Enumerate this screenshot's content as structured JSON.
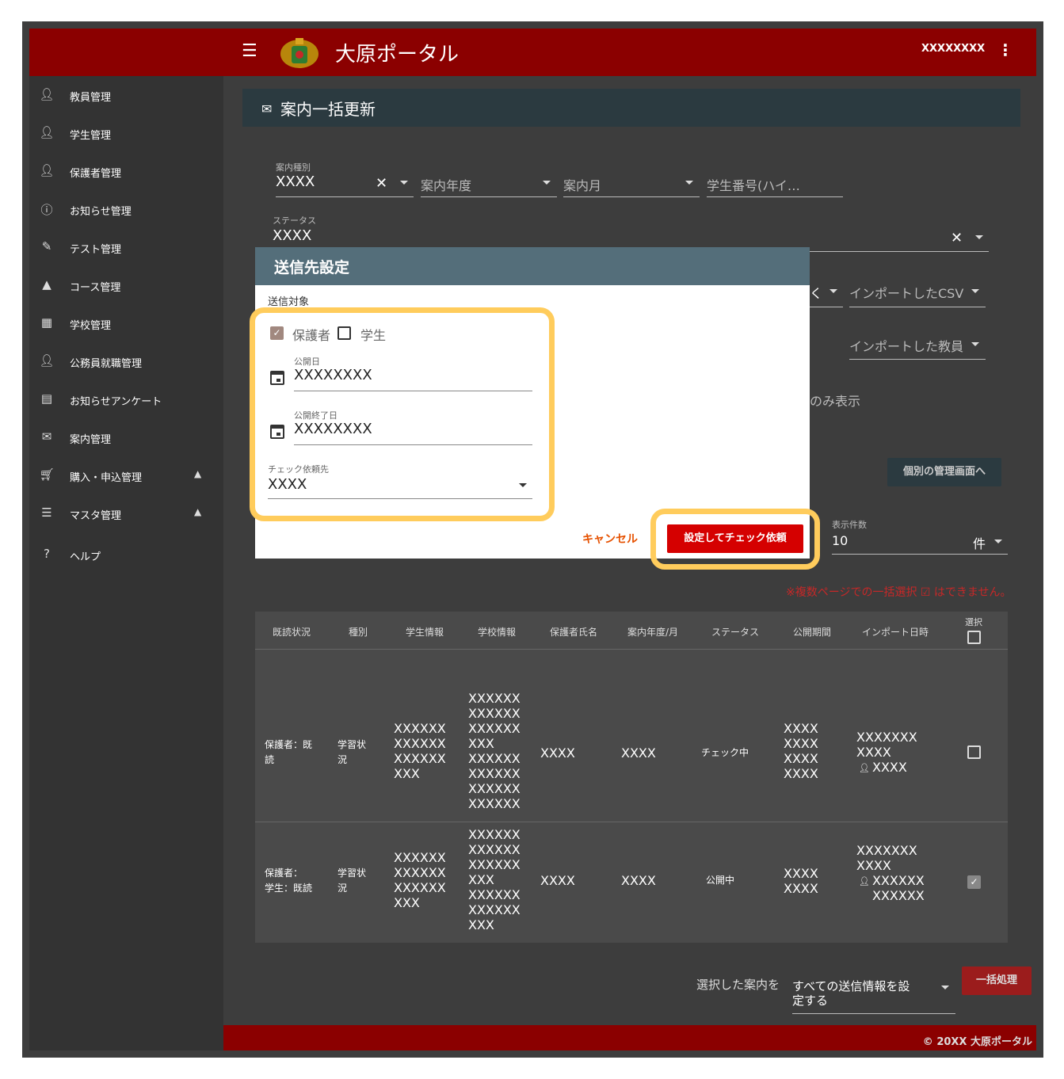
{
  "app": {
    "title": "大原ポータル",
    "user": "XXXXXXXX"
  },
  "sidebar": {
    "items": [
      {
        "label": "教員管理",
        "icon": "person-icon"
      },
      {
        "label": "学生管理",
        "icon": "person-icon"
      },
      {
        "label": "保護者管理",
        "icon": "person-icon"
      },
      {
        "label": "お知らせ管理",
        "icon": "info-icon"
      },
      {
        "label": "テスト管理",
        "icon": "pencil-icon"
      },
      {
        "label": "コース管理",
        "icon": "school-icon"
      },
      {
        "label": "学校管理",
        "icon": "building-icon"
      },
      {
        "label": "公務員就職管理",
        "icon": "person-icon"
      },
      {
        "label": "お知らせアンケート",
        "icon": "clipboard-icon"
      },
      {
        "label": "案内管理",
        "icon": "mail-icon"
      },
      {
        "label": "購入・申込管理",
        "icon": "cart-icon"
      },
      {
        "label": "マスタ管理",
        "icon": "list-icon"
      },
      {
        "label": "ヘルプ",
        "icon": "help-icon"
      }
    ]
  },
  "page": {
    "title": "案内一括更新"
  },
  "filters": {
    "type_caption": "案内種別",
    "type_value": "XXXX",
    "year_placeholder": "案内年度",
    "month_placeholder": "案内月",
    "student_placeholder": "学生番号(ハイ…",
    "status_caption": "ステータス",
    "status_value": "XXXX",
    "csv_placeholder": "インポートしたCSV",
    "teacher_placeholder": "インポートした教員",
    "only_show_partial": "のみ表示",
    "x_partial": "く"
  },
  "actions": {
    "individual_button": "個別の管理画面へ",
    "per_page_caption": "表示件数",
    "per_page_value": "10",
    "per_page_unit": "件",
    "note": "※複数ページでの一括選択 ☑ はできません。"
  },
  "table": {
    "headers": [
      "既読状況",
      "種別",
      "学生情報",
      "学校情報",
      "保護者氏名",
      "案内年度/月",
      "ステータス",
      "公開期間",
      "インポート日時",
      "選択"
    ],
    "rows": [
      {
        "read": "保護者：既\n読",
        "kind": "学習状\n況",
        "student": "XXXXXX\nXXXXXX\nXXXXXX\nXXX",
        "school": "XXXXXX\nXXXXXX\nXXXXXX\nXXX\nXXXXXX\nXXXXXX\nXXXXXX\nXXXXXX",
        "guardian": "XXXX",
        "yearmonth": "XXXX",
        "status": "チェック中",
        "period": "XXXX\nXXXX\nXXXX\nXXXX",
        "import_line1": "XXXXXXX",
        "import_line2": "XXXX",
        "import_user": "XXXX",
        "selected": false
      },
      {
        "read": "保護者：\n学生：既読",
        "kind": "学習状\n況",
        "student": "XXXXXX\nXXXXXX\nXXXXXX\nXXX",
        "school": "XXXXXX\nXXXXXX\nXXXXXX\nXXX\nXXXXXX\nXXXXXX\nXXX",
        "guardian": "XXXX",
        "yearmonth": "XXXX",
        "status": "公開中",
        "period": "XXXX\nXXXX",
        "import_line1": "XXXXXXX",
        "import_line2": "XXXX",
        "import_user": "XXXXXX\nXXXXXX",
        "selected": true
      }
    ]
  },
  "bulk": {
    "label": "選択した案内を",
    "select_value": "すべての送信情報を設\n定する",
    "button": "一括処理"
  },
  "footer": {
    "copyright": "© 20XX 大原ポータル"
  },
  "dialog": {
    "title": "送信先設定",
    "target_label": "送信対象",
    "guardian_label": "保護者",
    "guardian_checked": true,
    "student_label": "学生",
    "student_checked": false,
    "publish_caption": "公開日",
    "publish_value": "XXXXXXXX",
    "end_caption": "公開終了日",
    "end_value": "XXXXXXXX",
    "check_caption": "チェック依頼先",
    "check_value": "XXXX",
    "cancel_button": "キャンセル",
    "submit_button": "設定してチェック依頼"
  },
  "colors": {
    "brand": "#8b0000",
    "header": "#2b3a40",
    "dialog_header": "#546e7a",
    "highlight": "#ffcc5c",
    "submit": "#d50000",
    "cancel_text": "#e65100"
  }
}
